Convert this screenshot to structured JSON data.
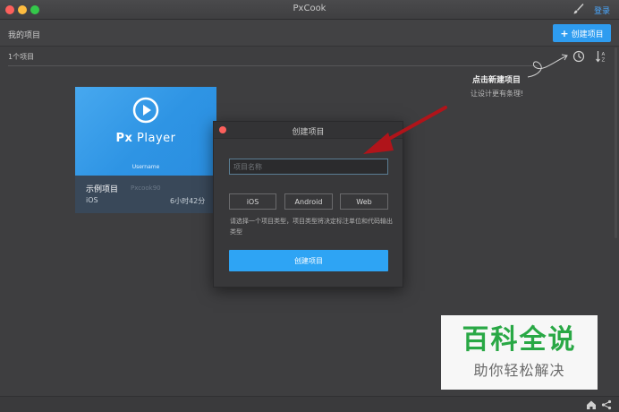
{
  "window": {
    "title": "PxCook",
    "login_label": "登录"
  },
  "header": {
    "my_projects": "我的项目",
    "create_button_label": "创建项目",
    "project_count": "1个项目"
  },
  "hint": {
    "title": "点击新建项目",
    "subtitle": "让设计更有条理!"
  },
  "project_card": {
    "thumb_title_bold": "Px",
    "thumb_title_rest": " Player",
    "thumb_user": "Username",
    "name": "示例项目",
    "owner": "Pxcook90",
    "platform": "iOS",
    "updated": "6小时42分"
  },
  "dialog": {
    "title": "创建项目",
    "name_placeholder": "项目名称",
    "types": [
      "iOS",
      "Android",
      "Web"
    ],
    "description": "请选择一个项目类型，项目类型将决定标注单位和代码输出类型",
    "submit_label": "创建项目"
  },
  "watermark": {
    "title": "百科全说",
    "subtitle": "助你轻松解决"
  },
  "colors": {
    "accent": "#2ea4f4",
    "link": "#4aa8ff",
    "arrow": "#b0141a",
    "watermark_green": "#29a845"
  },
  "icons": [
    "brush-icon",
    "plus-icon",
    "clock-icon",
    "sort-icon",
    "play-icon",
    "close-icon",
    "home-icon",
    "share-icon"
  ]
}
